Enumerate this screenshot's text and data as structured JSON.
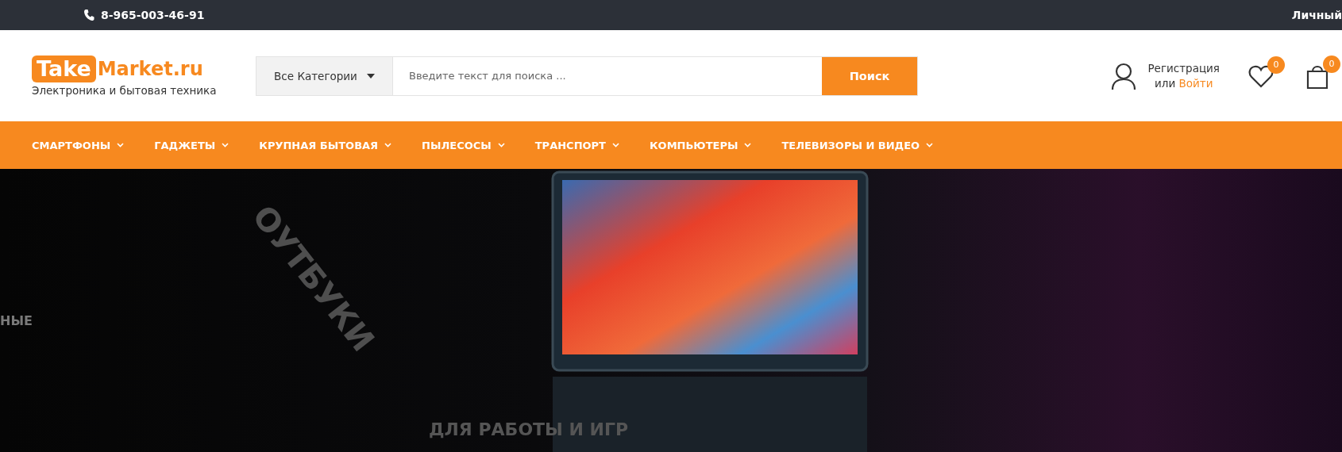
{
  "top_bar": {
    "phone": "8-965-003-46-91",
    "account_link": "Личный"
  },
  "header": {
    "logo": {
      "word_boxed": "Take",
      "word_plain": "Market.ru",
      "tagline": "Электроника и бытовая техника"
    },
    "search": {
      "category": "Все Категории",
      "placeholder": "Введите текст для поиска ...",
      "button": "Поиск"
    },
    "account": {
      "register": "Регистрация",
      "or": "или",
      "login": "Войти"
    },
    "wishlist_count": "0",
    "cart_count": "0"
  },
  "nav": [
    {
      "label": "СМАРТФОНЫ"
    },
    {
      "label": "ГАДЖЕТЫ"
    },
    {
      "label": "КРУПНАЯ БЫТОВАЯ"
    },
    {
      "label": "ПЫЛЕСОСЫ"
    },
    {
      "label": "ТРАНСПОРТ"
    },
    {
      "label": "КОМПЬЮТЕРЫ"
    },
    {
      "label": "ТЕЛЕВИЗОРЫ И ВИДЕО"
    }
  ],
  "hero": {
    "captions": [
      {
        "kind": "left",
        "text": "НЫЕ"
      },
      {
        "kind": "diagonal",
        "text": "ОУТБУКИ"
      },
      {
        "kind": "bottom",
        "text": "ДЛЯ РАБОТЫ И ИГР"
      }
    ]
  }
}
